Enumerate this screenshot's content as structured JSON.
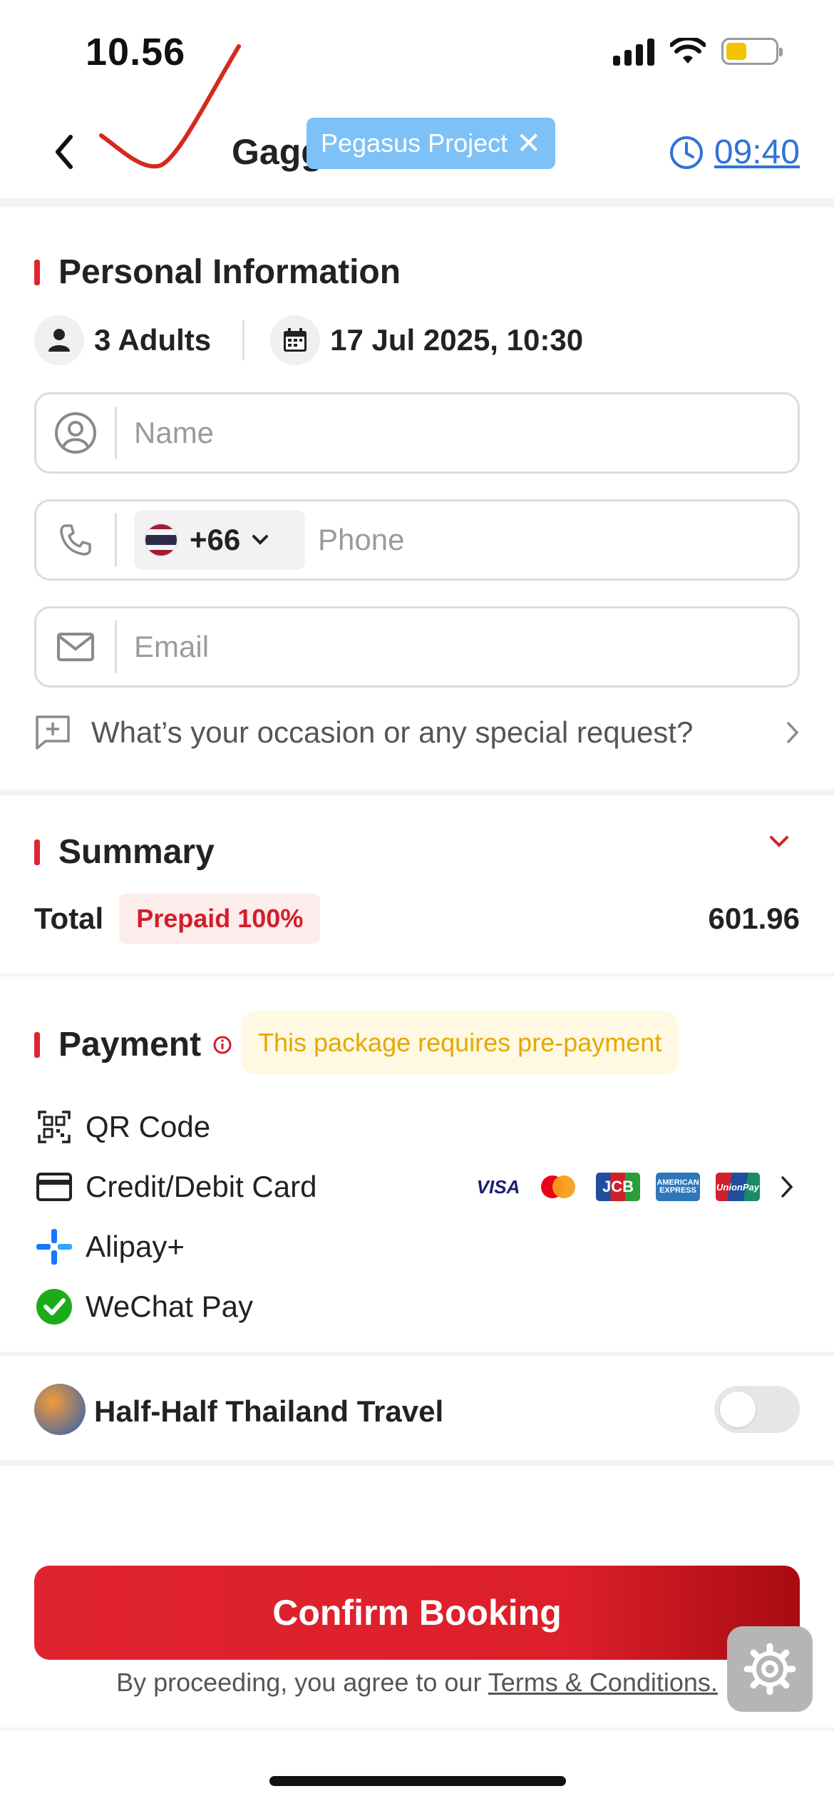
{
  "status_bar": {
    "time": "10.56"
  },
  "header": {
    "venue_name": "Gagg",
    "overlay_badge": "Pegasus Project",
    "overlay_close": "✕",
    "timer": "09:40"
  },
  "personal": {
    "title": "Personal Information",
    "guests": "3 Adults",
    "datetime": "17 Jul 2025, 10:30",
    "name_placeholder": "Name",
    "country_code": "+66",
    "phone_placeholder": "Phone",
    "email_placeholder": "Email",
    "special_request": "What’s your occasion or any special request?"
  },
  "summary": {
    "title": "Summary",
    "total_label": "Total",
    "prepaid_badge": "Prepaid 100%",
    "total_amount": "601.96"
  },
  "payment": {
    "title": "Payment",
    "notice": "This package requires pre-payment",
    "methods": [
      {
        "label": "QR Code",
        "icon": "qr-code-icon"
      },
      {
        "label": "Credit/Debit Card",
        "icon": "credit-card-icon"
      },
      {
        "label": "Alipay+",
        "icon": "alipay-icon"
      },
      {
        "label": "WeChat Pay",
        "icon": "wechat-icon"
      }
    ],
    "card_brands": [
      "VISA",
      "Mastercard",
      "JCB",
      "AMERICAN EXPRESS",
      "UnionPay"
    ]
  },
  "half_half": {
    "label": "Half-Half Thailand Travel",
    "enabled": false
  },
  "footer": {
    "confirm_label": "Confirm Booking",
    "terms_prefix": "By proceeding, you agree to our ",
    "terms_link": "Terms & Conditions."
  },
  "colors": {
    "accent_red": "#e0242f",
    "link_blue": "#2f73d9",
    "notice_yellow": "#e5a800",
    "badge_blue": "#7dc1f7"
  }
}
